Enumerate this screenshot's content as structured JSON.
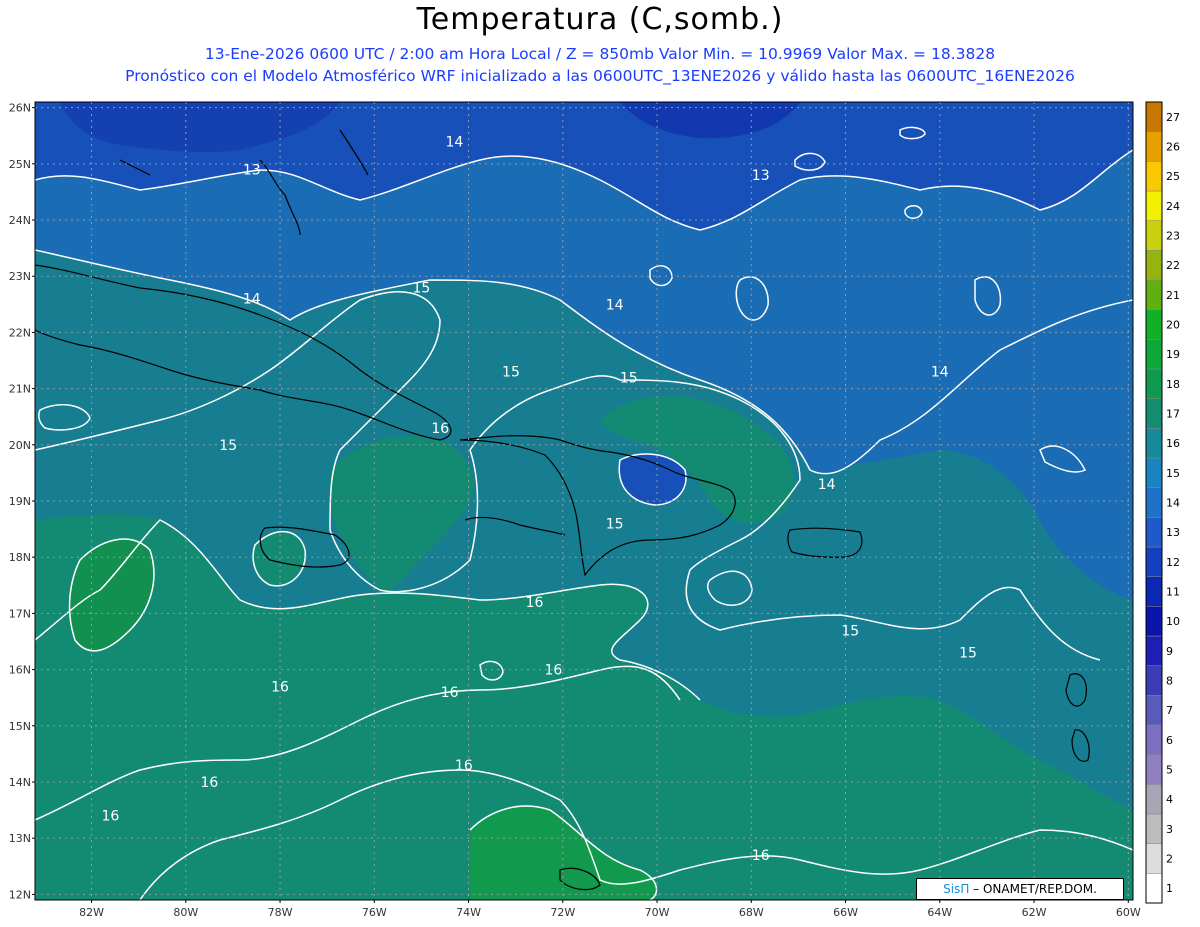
{
  "title": "Temperatura (C,somb.)",
  "subtitle_line1": "13-Ene-2026  0600 UTC / 2:00 am Hora Local / Z = 850mb     Valor Min. = 10.9969  Valor Max. = 18.3828",
  "subtitle_line2": "Pronóstico con el Modelo Atmosférico WRF inicializado a las 0600UTC_13ENE2026 y válido hasta las  0600UTC_16ENE2026",
  "credit": {
    "brand": "SisΠ",
    "text": "– ONAMET/REP.DOM."
  },
  "lat_labels": [
    "26N",
    "25N",
    "24N",
    "23N",
    "22N",
    "21N",
    "20N",
    "19N",
    "18N",
    "17N",
    "16N",
    "15N",
    "14N",
    "13N",
    "12N"
  ],
  "lon_labels": [
    "82W",
    "80W",
    "78W",
    "76W",
    "74W",
    "72W",
    "70W",
    "68W",
    "66W",
    "64W",
    "62W",
    "60W"
  ],
  "colorbar": {
    "levels": [
      "1",
      "2",
      "3",
      "4",
      "5",
      "6",
      "7",
      "8",
      "9",
      "10",
      "11",
      "12",
      "13",
      "14",
      "15",
      "16",
      "17",
      "18",
      "19",
      "20",
      "21",
      "22",
      "23",
      "24",
      "25",
      "26",
      "27"
    ],
    "colors": [
      "#ffffff",
      "#dcdcdc",
      "#bdbdbd",
      "#a6a6b6",
      "#9080c0",
      "#7c6ec0",
      "#5a5ab8",
      "#3c3cb4",
      "#1e1eb4",
      "#0a14aa",
      "#0a28b4",
      "#1440c0",
      "#1e5ac8",
      "#2072c8",
      "#1a84c0",
      "#178a9a",
      "#148c70",
      "#109a50",
      "#0ca838",
      "#10b028",
      "#60b010",
      "#96b410",
      "#c8d010",
      "#f0f000",
      "#f8c800",
      "#e8a000",
      "#c87800"
    ]
  },
  "contour_labels": [
    {
      "value": "13",
      "lon": -78.6,
      "lat": 24.9
    },
    {
      "value": "14",
      "lon": -74.3,
      "lat": 25.4
    },
    {
      "value": "13",
      "lon": -67.8,
      "lat": 24.8
    },
    {
      "value": "14",
      "lon": -78.6,
      "lat": 22.6
    },
    {
      "value": "15",
      "lon": -75.0,
      "lat": 22.8
    },
    {
      "value": "14",
      "lon": -70.9,
      "lat": 22.5
    },
    {
      "value": "15",
      "lon": -73.1,
      "lat": 21.3
    },
    {
      "value": "15",
      "lon": -70.6,
      "lat": 21.2
    },
    {
      "value": "14",
      "lon": -64.0,
      "lat": 21.3
    },
    {
      "value": "16",
      "lon": -74.6,
      "lat": 20.3
    },
    {
      "value": "15",
      "lon": -79.1,
      "lat": 20.0
    },
    {
      "value": "14",
      "lon": -66.4,
      "lat": 19.3
    },
    {
      "value": "15",
      "lon": -70.9,
      "lat": 18.6
    },
    {
      "value": "16",
      "lon": -72.6,
      "lat": 17.2
    },
    {
      "value": "15",
      "lon": -65.9,
      "lat": 16.7
    },
    {
      "value": "15",
      "lon": -63.4,
      "lat": 16.3
    },
    {
      "value": "16",
      "lon": -72.2,
      "lat": 16.0
    },
    {
      "value": "16",
      "lon": -78.0,
      "lat": 15.7
    },
    {
      "value": "16",
      "lon": -74.4,
      "lat": 15.6
    },
    {
      "value": "16",
      "lon": -74.1,
      "lat": 14.3
    },
    {
      "value": "16",
      "lon": -79.5,
      "lat": 14.0
    },
    {
      "value": "16",
      "lon": -81.6,
      "lat": 13.4
    },
    {
      "value": "16",
      "lon": -67.8,
      "lat": 12.7
    }
  ]
}
